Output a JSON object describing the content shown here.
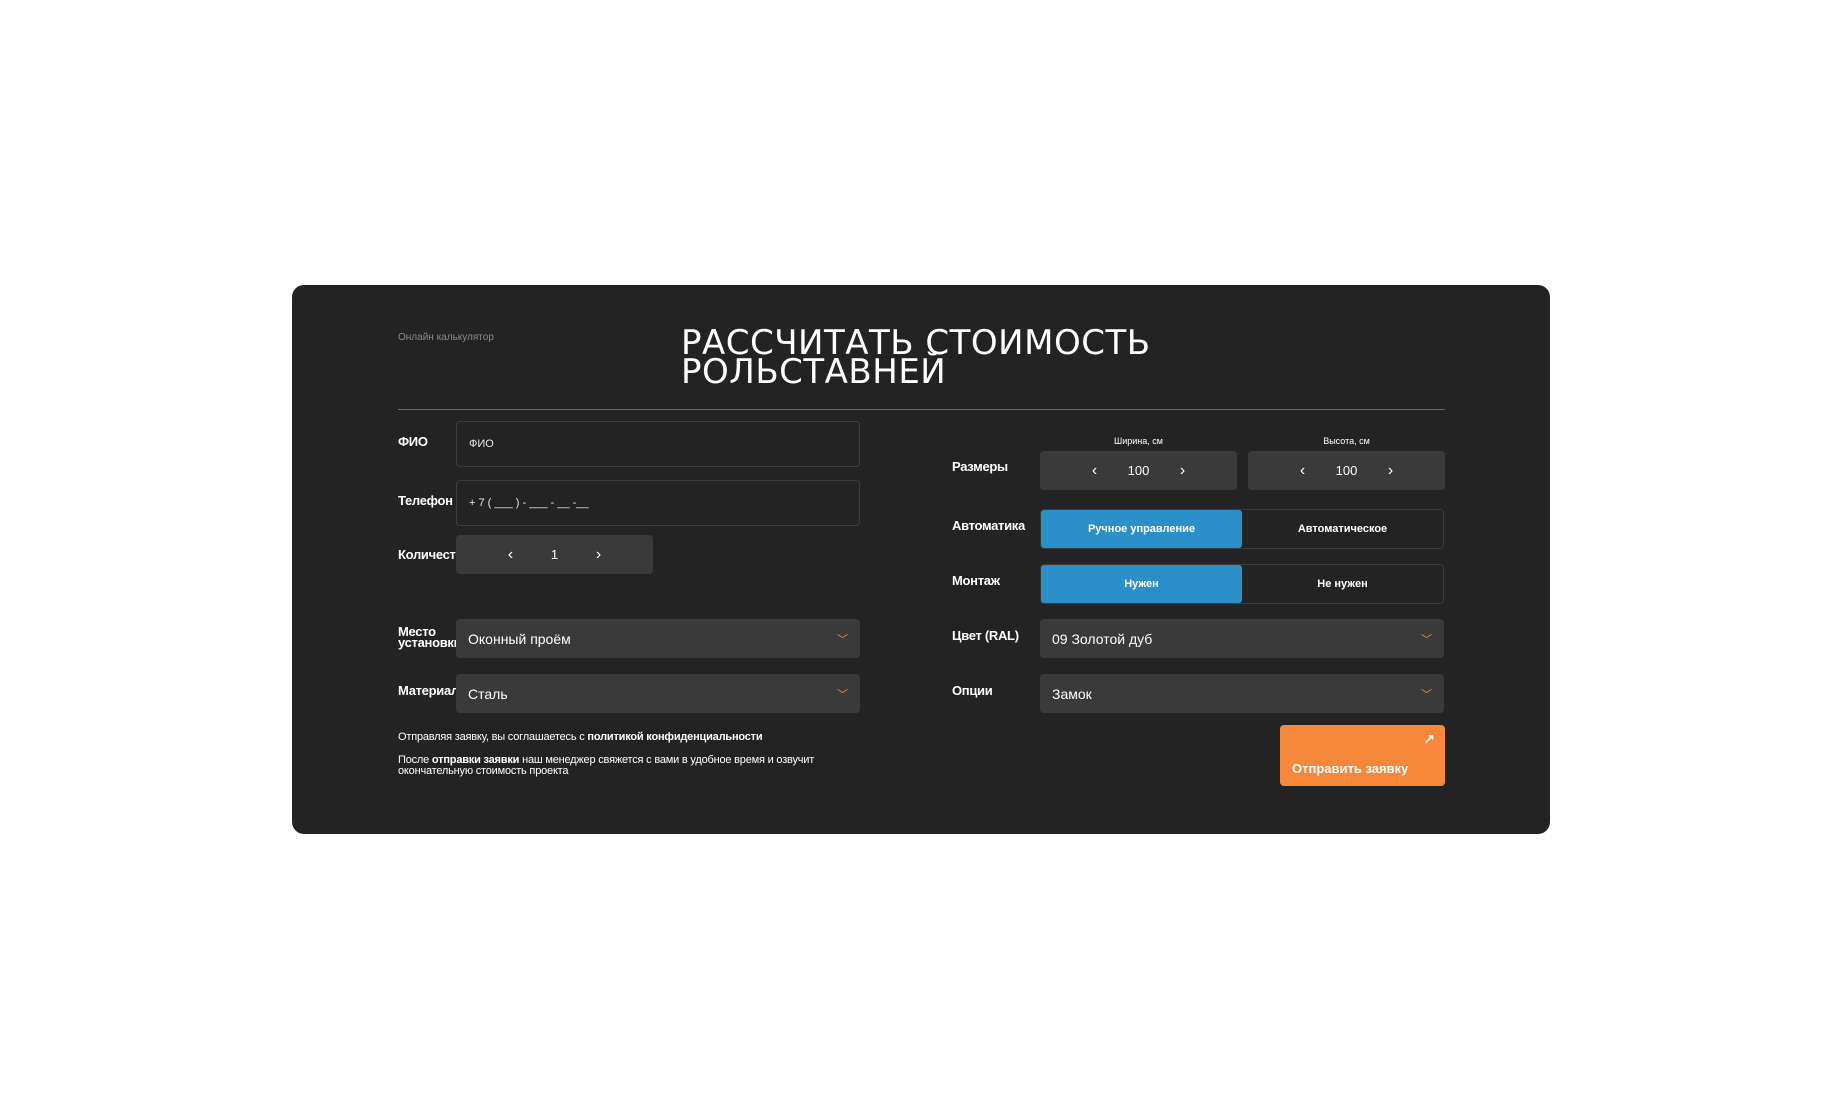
{
  "eyebrow": "Онлайн калькулятор",
  "title_line1": "РАССЧИТАТЬ СТОИМОСТЬ",
  "title_line2": "РОЛЬСТАВНЕЙ",
  "fio": {
    "label": "ФИО",
    "placeholder": "ФИО",
    "value": ""
  },
  "phone": {
    "label": "Телефон",
    "placeholder": "+ 7 ( ___ ) - ___ - __ -__",
    "value": ""
  },
  "quantity": {
    "label": "Количество",
    "value": "1",
    "prev_icon": "‹",
    "next_icon": "›"
  },
  "location": {
    "label_line1": "Место",
    "label_line2": "установки",
    "value": "Оконный проём"
  },
  "material": {
    "label": "Материал",
    "value": "Сталь"
  },
  "sizes": {
    "label": "Размеры",
    "width_label": "Ширина, см",
    "width_value": "100",
    "height_label": "Высота, см",
    "height_value": "100"
  },
  "automation": {
    "label": "Автоматика",
    "options": [
      "Ручное управление",
      "Автоматическое"
    ],
    "selected": 0
  },
  "mounting": {
    "label": "Монтаж",
    "options": [
      "Нужен",
      "Не нужен"
    ],
    "selected": 0
  },
  "color": {
    "label": "Цвет (RAL)",
    "value": "09 Золотой дуб"
  },
  "options": {
    "label": "Опции",
    "value": "Замок"
  },
  "consent": {
    "prefix": "Отправляя заявку, вы соглашаетесь с ",
    "link": "политикой конфиденциальности"
  },
  "note": {
    "prefix": "После ",
    "bold": "отправки заявки",
    "suffix": " наш менеджер свяжется с вами в удобное время и озвучит окончательную стоимость проекта"
  },
  "submit": {
    "label": "Отправить заявку",
    "icon": "↗"
  },
  "colors": {
    "background": "#232323",
    "accent": "#f5883a",
    "selected": "#2b90c9",
    "field": "#3a3a3a"
  }
}
